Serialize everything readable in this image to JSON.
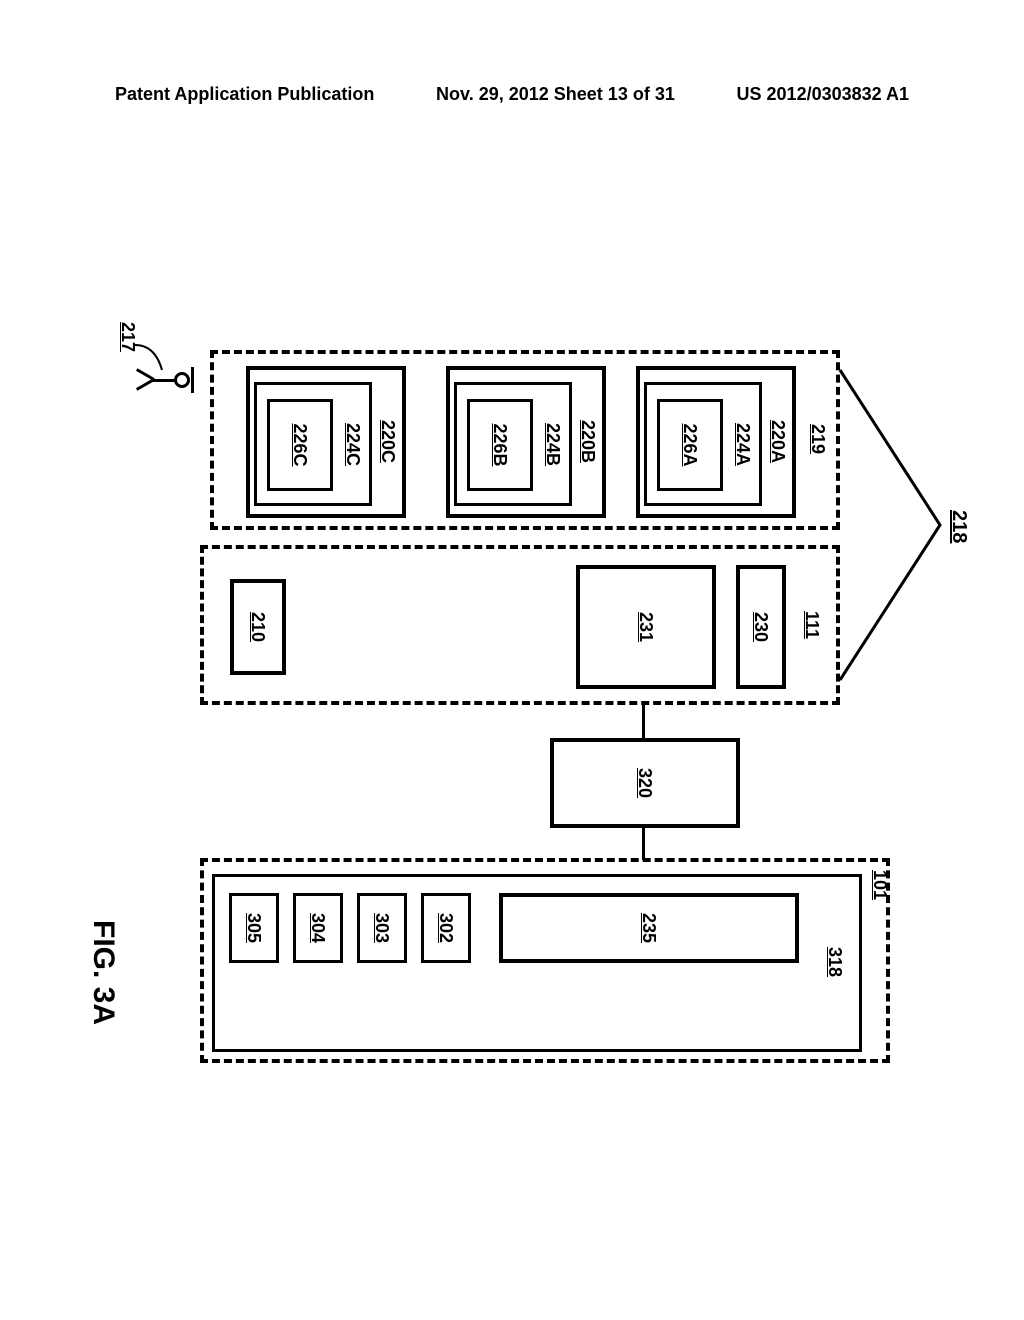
{
  "header": {
    "left": "Patent Application Publication",
    "center": "Nov. 29, 2012  Sheet 13 of 31",
    "right": "US 2012/0303832 A1"
  },
  "figure_label": "FIG. 3A",
  "refs": {
    "r218": "218",
    "r217": "217",
    "r219": "219",
    "r220A": "220A",
    "r224A": "224A",
    "r226A": "226A",
    "r220B": "220B",
    "r224B": "224B",
    "r226B": "226B",
    "r220C": "220C",
    "r224C": "224C",
    "r226C": "226C",
    "r111": "111",
    "r230": "230",
    "r231": "231",
    "r210": "210",
    "r320": "320",
    "r101": "101",
    "r318": "318",
    "r235": "235",
    "r302": "302",
    "r303": "303",
    "r304": "304",
    "r305": "305"
  }
}
